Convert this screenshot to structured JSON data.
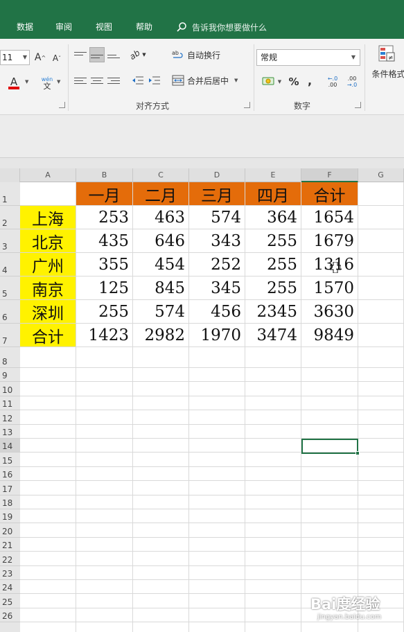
{
  "ribbon_tabs": [
    "数据",
    "审阅",
    "视图",
    "帮助"
  ],
  "tell_me": {
    "placeholder": "告诉我你想要做什么"
  },
  "font": {
    "size": "11",
    "grow_label": "A",
    "shrink_label": "A",
    "color_label": "A",
    "phonetic_top": "wén",
    "phonetic_bottom": "文"
  },
  "alignment": {
    "orient_label": "ab",
    "wrap_text_label": "自动换行",
    "merge_center_label": "合并后居中",
    "group_label": "对齐方式"
  },
  "number": {
    "format": "常规",
    "percent": "%",
    "comma": ",",
    "inc_decimal_top": "←.0",
    "inc_decimal_bottom": ".00",
    "dec_decimal_top": ".00",
    "dec_decimal_bottom": "→.0",
    "group_label": "数字"
  },
  "styles": {
    "conditional_format_label": "条件格式"
  },
  "sheet": {
    "columns": [
      "A",
      "B",
      "C",
      "D",
      "E",
      "F",
      "G"
    ],
    "rows": [
      "1",
      "2",
      "3",
      "4",
      "5",
      "6",
      "7",
      "8",
      "9",
      "10",
      "11",
      "12",
      "13",
      "14",
      "15",
      "16",
      "17",
      "18",
      "19",
      "20",
      "21",
      "22",
      "23",
      "24",
      "25",
      "26"
    ],
    "header_row": [
      "一月",
      "二月",
      "三月",
      "四月",
      "合计"
    ],
    "data_rows": [
      {
        "label": "上海",
        "values": [
          "253",
          "463",
          "574",
          "364",
          "1654"
        ]
      },
      {
        "label": "北京",
        "values": [
          "435",
          "646",
          "343",
          "255",
          "1679"
        ]
      },
      {
        "label": "广州",
        "values": [
          "355",
          "454",
          "252",
          "255",
          "1316"
        ]
      },
      {
        "label": "南京",
        "values": [
          "125",
          "845",
          "345",
          "255",
          "1570"
        ]
      },
      {
        "label": "深圳",
        "values": [
          "255",
          "574",
          "456",
          "2345",
          "3630"
        ]
      },
      {
        "label": "合计",
        "values": [
          "1423",
          "2982",
          "1970",
          "3474",
          "9849"
        ]
      }
    ],
    "active_column": "F",
    "active_row": "14",
    "header_color": "#e46c0a",
    "label_color": "#fff200",
    "accent_color": "#217346"
  },
  "watermark": {
    "brand": "Bai度经验",
    "url": "jingyan.baidu.com"
  }
}
